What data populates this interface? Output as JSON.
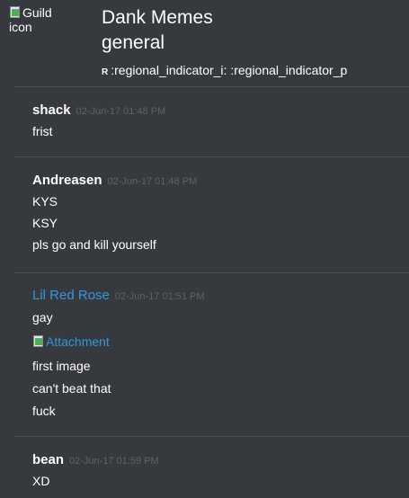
{
  "header": {
    "guild_icon_alt": "Guild icon",
    "guild_name": "Dank Memes",
    "channel_name": "general",
    "topic_prefix": "R",
    "topic_text": ":regional_indicator_i: :regional_indicator_p"
  },
  "messages": [
    {
      "author": "shack",
      "timestamp": "02-Jun-17 01:48 PM",
      "lines": [
        "frist"
      ]
    },
    {
      "author": "Andreasen",
      "timestamp": "02-Jun-17 01:48 PM",
      "lines": [
        "KYS",
        "KSY",
        "pls go and kill yourself"
      ]
    },
    {
      "author": "Lil Red Rose",
      "author_color": "#3498db",
      "timestamp": "02-Jun-17 01:51 PM",
      "lines": [
        "gay"
      ],
      "attachment_alt": "Attachment",
      "lines_after": [
        "first image",
        "can't beat that",
        "fuck"
      ]
    },
    {
      "author": "bean",
      "timestamp": "02-Jun-17 01:59 PM",
      "lines": [
        "XD"
      ]
    }
  ],
  "colors": {
    "background": "#36393e",
    "divider": "#4b4e54",
    "timestamp": "#5f6166",
    "link": "#3498db"
  }
}
